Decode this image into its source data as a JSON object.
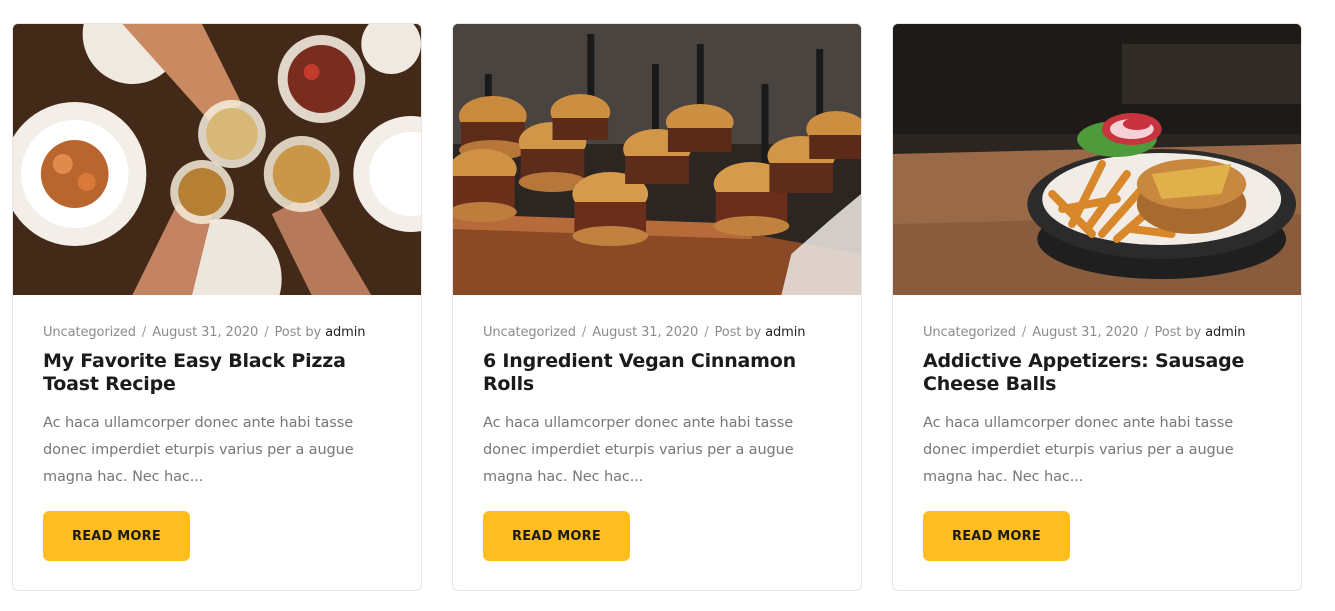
{
  "posts": [
    {
      "category": "Uncategorized",
      "date": "August 31, 2020",
      "post_by": "Post by",
      "author": "admin",
      "title": "My Favorite Easy Black Pizza Toast Recipe",
      "excerpt": "Ac haca ullamcorper donec ante habi tasse donec imperdiet eturpis varius per a augue magna hac. Nec hac...",
      "button": "READ MORE",
      "image_icon": "cheers-drinks-image"
    },
    {
      "category": "Uncategorized",
      "date": "August 31, 2020",
      "post_by": "Post by",
      "author": "admin",
      "title": "6 Ingredient Vegan Cinnamon Rolls",
      "excerpt": "Ac haca ullamcorper donec ante habi tasse donec imperdiet eturpis varius per a augue magna hac. Nec hac...",
      "button": "READ MORE",
      "image_icon": "burger-sliders-image"
    },
    {
      "category": "Uncategorized",
      "date": "August 31, 2020",
      "post_by": "Post by",
      "author": "admin",
      "title": "Addictive Appetizers: Sausage Cheese Balls",
      "excerpt": "Ac haca ullamcorper donec ante habi tasse donec imperdiet eturpis varius per a augue magna hac. Nec hac...",
      "button": "READ MORE",
      "image_icon": "fries-basket-image"
    }
  ],
  "colors": {
    "accent": "#ffbe1f",
    "title": "#1b1b1b",
    "meta": "#8c8c8c",
    "excerpt": "#777777",
    "border": "#e6e6e6"
  }
}
